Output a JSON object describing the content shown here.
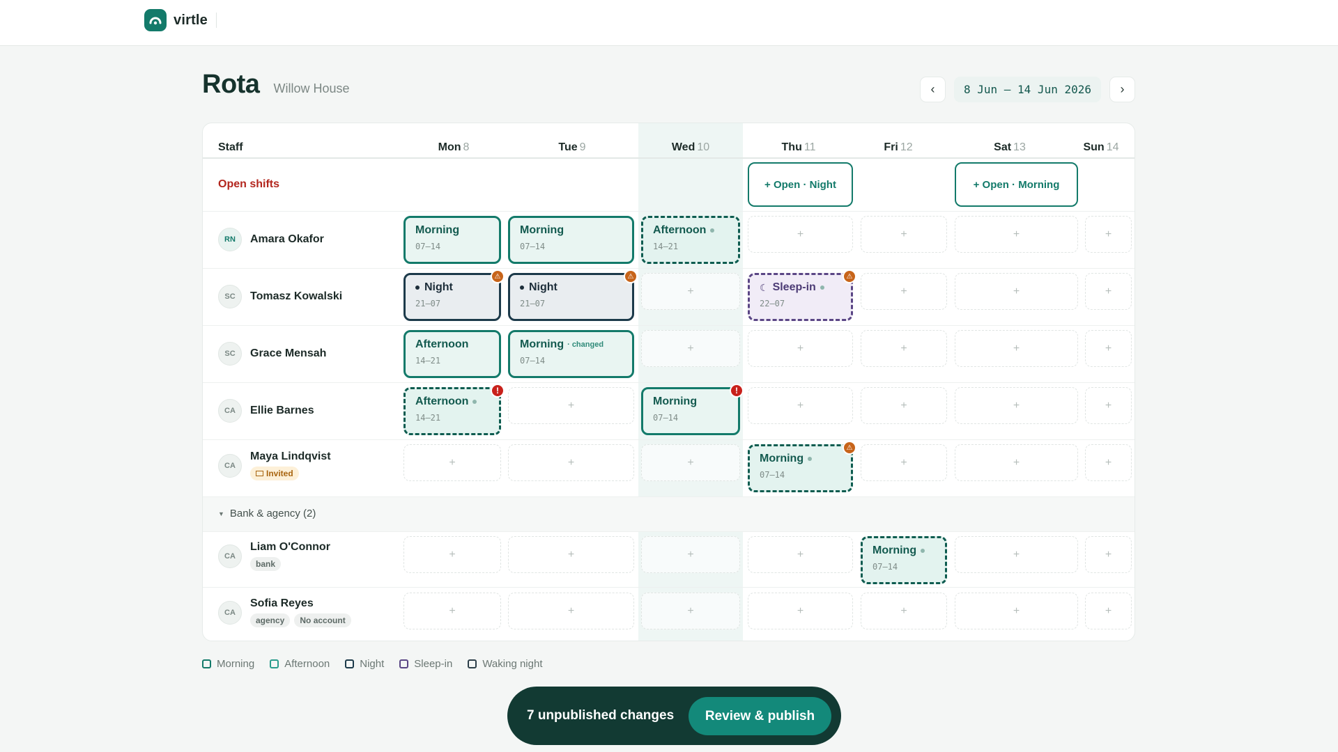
{
  "app": {
    "name": "virtle"
  },
  "page": {
    "title": "Rota",
    "subtitle": "Willow House"
  },
  "week": {
    "prev": "‹",
    "range": "8 Jun – 14 Jun 2026",
    "next": "›"
  },
  "grid": {
    "staff_header": "Staff",
    "days": [
      {
        "name": "Mon",
        "num": "8"
      },
      {
        "name": "Tue",
        "num": "9"
      },
      {
        "name": "Wed",
        "num": "10"
      },
      {
        "name": "Thu",
        "num": "11"
      },
      {
        "name": "Fri",
        "num": "12"
      },
      {
        "name": "Sat",
        "num": "13"
      },
      {
        "name": "Sun",
        "num": "14"
      }
    ],
    "open_shifts_label": "Open shifts",
    "open_shifts": [
      {
        "day": "Thu",
        "label": "+ Open · Night"
      },
      {
        "day": "Sat",
        "label": "+ Open · Morning"
      }
    ],
    "group_label": "Bank & agency (2)",
    "add_symbol": "+"
  },
  "staff": [
    {
      "initials": "RN",
      "name": "Amara Okafor",
      "tags": []
    },
    {
      "initials": "SC",
      "name": "Tomasz Kowalski",
      "tags": []
    },
    {
      "initials": "SC",
      "name": "Grace Mensah",
      "tags": []
    },
    {
      "initials": "CA",
      "name": "Ellie Barnes",
      "tags": []
    },
    {
      "initials": "CA",
      "name": "Maya Lindqvist",
      "tags": [
        "Invited"
      ]
    },
    {
      "initials": "CA",
      "name": "Liam O'Connor",
      "tags": [
        "bank"
      ]
    },
    {
      "initials": "CA",
      "name": "Sofia Reyes",
      "tags": [
        "agency",
        "No account"
      ]
    }
  ],
  "shifts": {
    "amara_mon": {
      "name": "Morning",
      "time": "07–14"
    },
    "amara_tue": {
      "name": "Morning",
      "time": "07–14"
    },
    "amara_wed": {
      "name": "Afternoon",
      "time": "14–21"
    },
    "tomasz_mon": {
      "name": "Night",
      "time": "21–07"
    },
    "tomasz_tue": {
      "name": "Night",
      "time": "21–07"
    },
    "tomasz_thu": {
      "name": "Sleep-in",
      "time": "22–07"
    },
    "grace_mon": {
      "name": "Afternoon",
      "time": "14–21"
    },
    "grace_tue": {
      "name": "Morning",
      "time": "07–14",
      "note": "· changed"
    },
    "ellie_mon": {
      "name": "Afternoon",
      "time": "14–21"
    },
    "ellie_wed": {
      "name": "Morning",
      "time": "07–14"
    },
    "maya_thu": {
      "name": "Morning",
      "time": "07–14"
    },
    "liam_fri": {
      "name": "Morning",
      "time": "07–14"
    }
  },
  "badges": {
    "warning": "⚠",
    "error": "!"
  },
  "legend": [
    {
      "label": "Morning",
      "color": "#137a6a"
    },
    {
      "label": "Afternoon",
      "color": "#2a9c8c"
    },
    {
      "label": "Night",
      "color": "#1c3a4a"
    },
    {
      "label": "Sleep-in",
      "color": "#5a4685"
    },
    {
      "label": "Waking night",
      "color": "#2d3f4a"
    }
  ],
  "publish": {
    "changes": "7 unpublished changes",
    "button": "Review & publish"
  },
  "colors": {
    "accent": "#137a6a",
    "danger": "#b3261e",
    "warning": "#c7641a",
    "dark_bar": "#123a33"
  }
}
